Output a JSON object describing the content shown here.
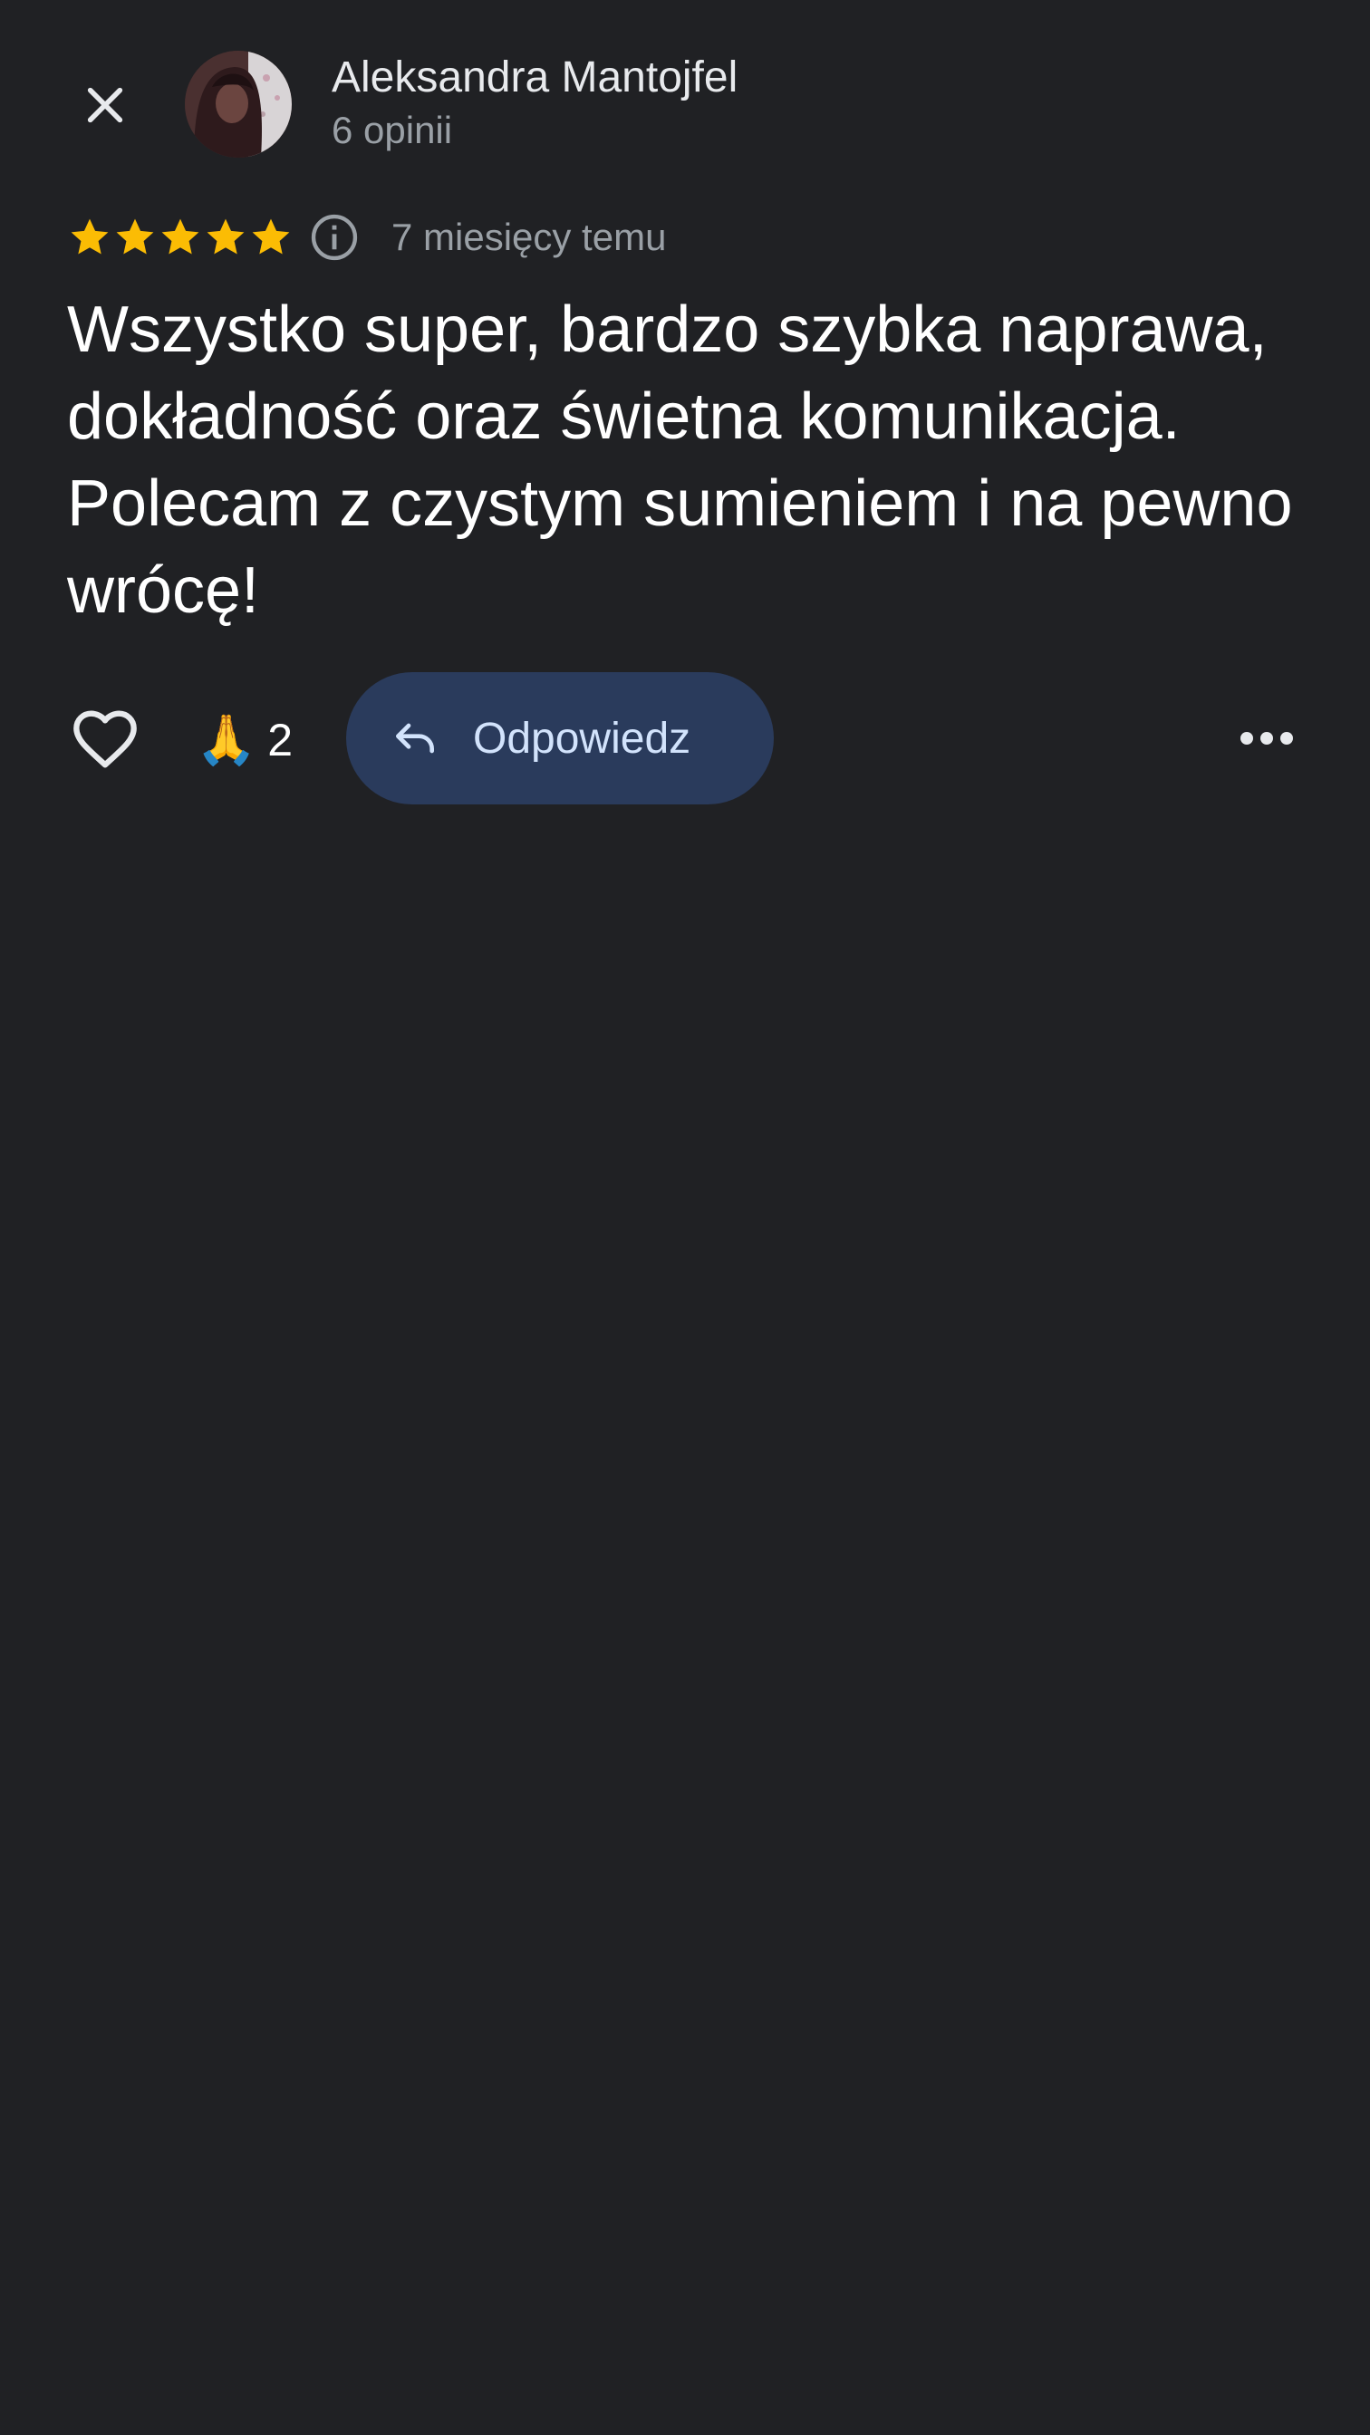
{
  "header": {
    "close_icon": "close-icon",
    "reviewer_name": "Aleksandra Mantojfel",
    "reviewer_count": "6 opinii"
  },
  "review": {
    "rating": 5,
    "max_rating": 5,
    "time": "7 miesięcy temu",
    "text": "Wszystko super, bardzo szybka naprawa, dokładność oraz świetna komunikacja. Polecam z czystym sumieniem i na pewno wrócę!"
  },
  "actions": {
    "reaction_emoji": "🙏",
    "reaction_count": "2",
    "reply_label": "Odpowiedz"
  },
  "colors": {
    "background": "#202124",
    "star": "#fbbc04",
    "reply_button_bg": "#2a3b5c",
    "reply_button_text": "#d2e3fc",
    "secondary_text": "#9aa0a6"
  }
}
